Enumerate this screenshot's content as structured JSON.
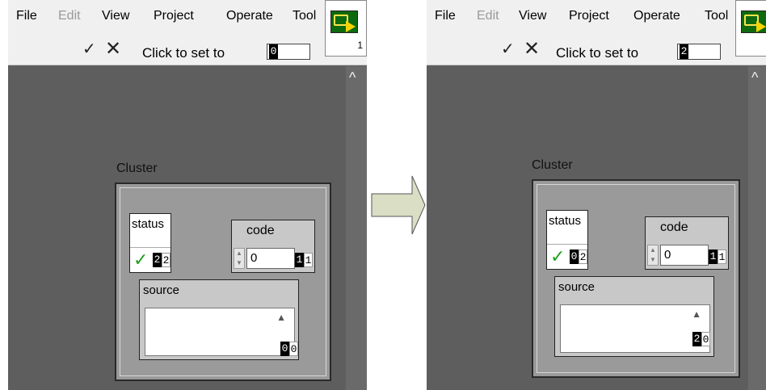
{
  "panels": [
    {
      "menu": {
        "file": "File",
        "edit": "Edit",
        "view": "View",
        "project": "Project",
        "operate": "Operate",
        "tools": "Tool"
      },
      "toolbar": {
        "confirm_glyph": "✓",
        "cancel_glyph": "✕",
        "set_label": "Click to set to",
        "set_value": "0"
      },
      "vi_icon_number": "1",
      "cluster": {
        "label": "Cluster",
        "status": {
          "label": "status",
          "index_black": "2",
          "index_white": "2"
        },
        "code": {
          "label": "code",
          "value": "0",
          "index_black": "1",
          "index_white": "1"
        },
        "source": {
          "label": "source",
          "index_black": "0",
          "index_white": "0"
        }
      }
    },
    {
      "menu": {
        "file": "File",
        "edit": "Edit",
        "view": "View",
        "project": "Project",
        "operate": "Operate",
        "tools": "Tool"
      },
      "toolbar": {
        "confirm_glyph": "✓",
        "cancel_glyph": "✕",
        "set_label": "Click to set to",
        "set_value": "2"
      },
      "vi_icon_number": "",
      "cluster": {
        "label": "Cluster",
        "status": {
          "label": "status",
          "index_black": "0",
          "index_white": "2"
        },
        "code": {
          "label": "code",
          "value": "0",
          "index_black": "1",
          "index_white": "1"
        },
        "source": {
          "label": "source",
          "index_black": "2",
          "index_white": "0"
        }
      }
    }
  ],
  "colors": {
    "panel_bg": "#5e5e5e",
    "cluster_bg": "#9a9a9a",
    "arrow_fill": "#d9dec4"
  },
  "icons": {
    "transition_arrow": "right-arrow-icon"
  }
}
